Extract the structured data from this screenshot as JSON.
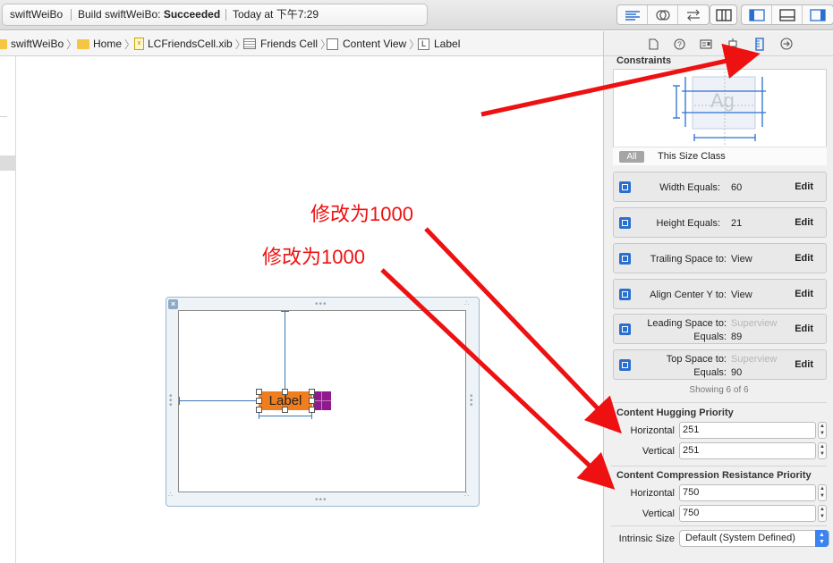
{
  "toolbar": {
    "project": "swiftWeiBo",
    "build_prefix": "Build swiftWeiBo: ",
    "build_status": "Succeeded",
    "time_label": "Today at 下午7:29"
  },
  "breadcrumb": {
    "items": [
      "swiftWeiBo",
      "Home",
      "LCFriendsCell.xib",
      "Friends Cell",
      "Content View",
      "Label"
    ]
  },
  "canvas": {
    "label_text": "Label"
  },
  "annotations": [
    "修改为1000",
    "修改为1000"
  ],
  "inspector": {
    "constraints_title": "Constraints",
    "preview_text": "Ag",
    "all_label": "All",
    "size_class_label": "This Size Class",
    "constraints": [
      {
        "key": "Width Equals:",
        "value": "60",
        "edit": "Edit"
      },
      {
        "key": "Height Equals:",
        "value": "21",
        "edit": "Edit"
      },
      {
        "key": "Trailing Space to:",
        "value": "View",
        "edit": "Edit"
      },
      {
        "key": "Align Center Y to:",
        "value": "View",
        "edit": "Edit"
      },
      {
        "key": "Leading Space to:",
        "target": "Superview",
        "key2": "Equals:",
        "value": "89",
        "edit": "Edit"
      },
      {
        "key": "Top Space to:",
        "target": "Superview",
        "key2": "Equals:",
        "value": "90",
        "edit": "Edit"
      }
    ],
    "showing": "Showing 6 of 6",
    "hugging": {
      "title": "Content Hugging Priority",
      "horizontal_label": "Horizontal",
      "horizontal_value": "251",
      "vertical_label": "Vertical",
      "vertical_value": "251"
    },
    "compression": {
      "title": "Content Compression Resistance Priority",
      "horizontal_label": "Horizontal",
      "horizontal_value": "750",
      "vertical_label": "Vertical",
      "vertical_value": "750"
    },
    "intrinsic": {
      "label": "Intrinsic Size",
      "value": "Default (System Defined)"
    }
  },
  "colors": {
    "annotation": "#ee1111",
    "label_fill": "#f07e1e",
    "constraint_line": "#3a76b7",
    "accent": "#2a6fd0"
  }
}
